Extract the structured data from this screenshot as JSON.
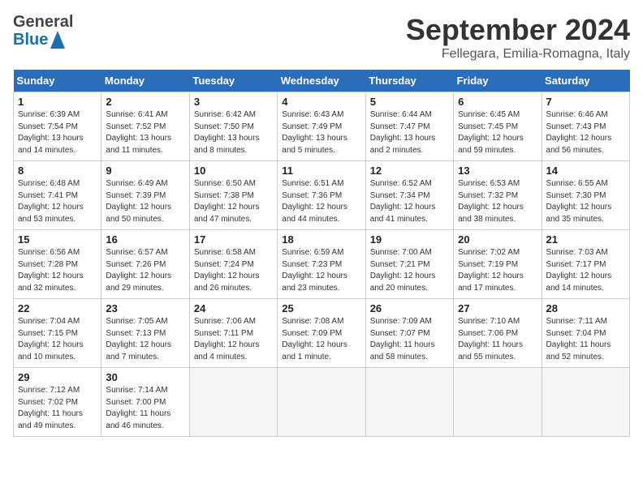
{
  "header": {
    "logo_general": "General",
    "logo_blue": "Blue",
    "month_title": "September 2024",
    "location": "Fellegara, Emilia-Romagna, Italy"
  },
  "days_of_week": [
    "Sunday",
    "Monday",
    "Tuesday",
    "Wednesday",
    "Thursday",
    "Friday",
    "Saturday"
  ],
  "weeks": [
    [
      {
        "day": 1,
        "info": "Sunrise: 6:39 AM\nSunset: 7:54 PM\nDaylight: 13 hours\nand 14 minutes."
      },
      {
        "day": 2,
        "info": "Sunrise: 6:41 AM\nSunset: 7:52 PM\nDaylight: 13 hours\nand 11 minutes."
      },
      {
        "day": 3,
        "info": "Sunrise: 6:42 AM\nSunset: 7:50 PM\nDaylight: 13 hours\nand 8 minutes."
      },
      {
        "day": 4,
        "info": "Sunrise: 6:43 AM\nSunset: 7:49 PM\nDaylight: 13 hours\nand 5 minutes."
      },
      {
        "day": 5,
        "info": "Sunrise: 6:44 AM\nSunset: 7:47 PM\nDaylight: 13 hours\nand 2 minutes."
      },
      {
        "day": 6,
        "info": "Sunrise: 6:45 AM\nSunset: 7:45 PM\nDaylight: 12 hours\nand 59 minutes."
      },
      {
        "day": 7,
        "info": "Sunrise: 6:46 AM\nSunset: 7:43 PM\nDaylight: 12 hours\nand 56 minutes."
      }
    ],
    [
      {
        "day": 8,
        "info": "Sunrise: 6:48 AM\nSunset: 7:41 PM\nDaylight: 12 hours\nand 53 minutes."
      },
      {
        "day": 9,
        "info": "Sunrise: 6:49 AM\nSunset: 7:39 PM\nDaylight: 12 hours\nand 50 minutes."
      },
      {
        "day": 10,
        "info": "Sunrise: 6:50 AM\nSunset: 7:38 PM\nDaylight: 12 hours\nand 47 minutes."
      },
      {
        "day": 11,
        "info": "Sunrise: 6:51 AM\nSunset: 7:36 PM\nDaylight: 12 hours\nand 44 minutes."
      },
      {
        "day": 12,
        "info": "Sunrise: 6:52 AM\nSunset: 7:34 PM\nDaylight: 12 hours\nand 41 minutes."
      },
      {
        "day": 13,
        "info": "Sunrise: 6:53 AM\nSunset: 7:32 PM\nDaylight: 12 hours\nand 38 minutes."
      },
      {
        "day": 14,
        "info": "Sunrise: 6:55 AM\nSunset: 7:30 PM\nDaylight: 12 hours\nand 35 minutes."
      }
    ],
    [
      {
        "day": 15,
        "info": "Sunrise: 6:56 AM\nSunset: 7:28 PM\nDaylight: 12 hours\nand 32 minutes."
      },
      {
        "day": 16,
        "info": "Sunrise: 6:57 AM\nSunset: 7:26 PM\nDaylight: 12 hours\nand 29 minutes."
      },
      {
        "day": 17,
        "info": "Sunrise: 6:58 AM\nSunset: 7:24 PM\nDaylight: 12 hours\nand 26 minutes."
      },
      {
        "day": 18,
        "info": "Sunrise: 6:59 AM\nSunset: 7:23 PM\nDaylight: 12 hours\nand 23 minutes."
      },
      {
        "day": 19,
        "info": "Sunrise: 7:00 AM\nSunset: 7:21 PM\nDaylight: 12 hours\nand 20 minutes."
      },
      {
        "day": 20,
        "info": "Sunrise: 7:02 AM\nSunset: 7:19 PM\nDaylight: 12 hours\nand 17 minutes."
      },
      {
        "day": 21,
        "info": "Sunrise: 7:03 AM\nSunset: 7:17 PM\nDaylight: 12 hours\nand 14 minutes."
      }
    ],
    [
      {
        "day": 22,
        "info": "Sunrise: 7:04 AM\nSunset: 7:15 PM\nDaylight: 12 hours\nand 10 minutes."
      },
      {
        "day": 23,
        "info": "Sunrise: 7:05 AM\nSunset: 7:13 PM\nDaylight: 12 hours\nand 7 minutes."
      },
      {
        "day": 24,
        "info": "Sunrise: 7:06 AM\nSunset: 7:11 PM\nDaylight: 12 hours\nand 4 minutes."
      },
      {
        "day": 25,
        "info": "Sunrise: 7:08 AM\nSunset: 7:09 PM\nDaylight: 12 hours\nand 1 minute."
      },
      {
        "day": 26,
        "info": "Sunrise: 7:09 AM\nSunset: 7:07 PM\nDaylight: 11 hours\nand 58 minutes."
      },
      {
        "day": 27,
        "info": "Sunrise: 7:10 AM\nSunset: 7:06 PM\nDaylight: 11 hours\nand 55 minutes."
      },
      {
        "day": 28,
        "info": "Sunrise: 7:11 AM\nSunset: 7:04 PM\nDaylight: 11 hours\nand 52 minutes."
      }
    ],
    [
      {
        "day": 29,
        "info": "Sunrise: 7:12 AM\nSunset: 7:02 PM\nDaylight: 11 hours\nand 49 minutes."
      },
      {
        "day": 30,
        "info": "Sunrise: 7:14 AM\nSunset: 7:00 PM\nDaylight: 11 hours\nand 46 minutes."
      },
      null,
      null,
      null,
      null,
      null
    ]
  ]
}
